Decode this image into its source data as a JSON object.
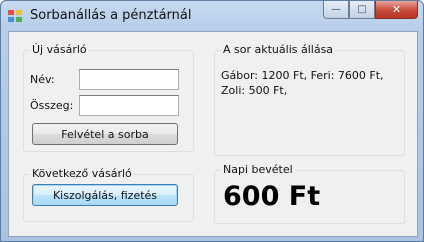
{
  "window": {
    "title": "Sorbanállás a pénztárnál",
    "minimize_glyph": "—",
    "maximize_glyph": "□",
    "close_glyph": "✕"
  },
  "new_customer": {
    "group_label": "Új vásárló",
    "name_label": "Név:",
    "name_value": "",
    "amount_label": "Összeg:",
    "amount_value": "",
    "add_button": "Felvétel a sorba"
  },
  "queue_state": {
    "group_label": "A sor aktuális állása",
    "text": "Gábor: 1200 Ft, Feri: 7600 Ft, Zoli: 500 Ft,"
  },
  "next_customer": {
    "group_label": "Következő vásárló",
    "serve_button": "Kiszolgálás, fizetés"
  },
  "daily_revenue": {
    "group_label": "Napi bevétel",
    "value": "600 Ft"
  }
}
